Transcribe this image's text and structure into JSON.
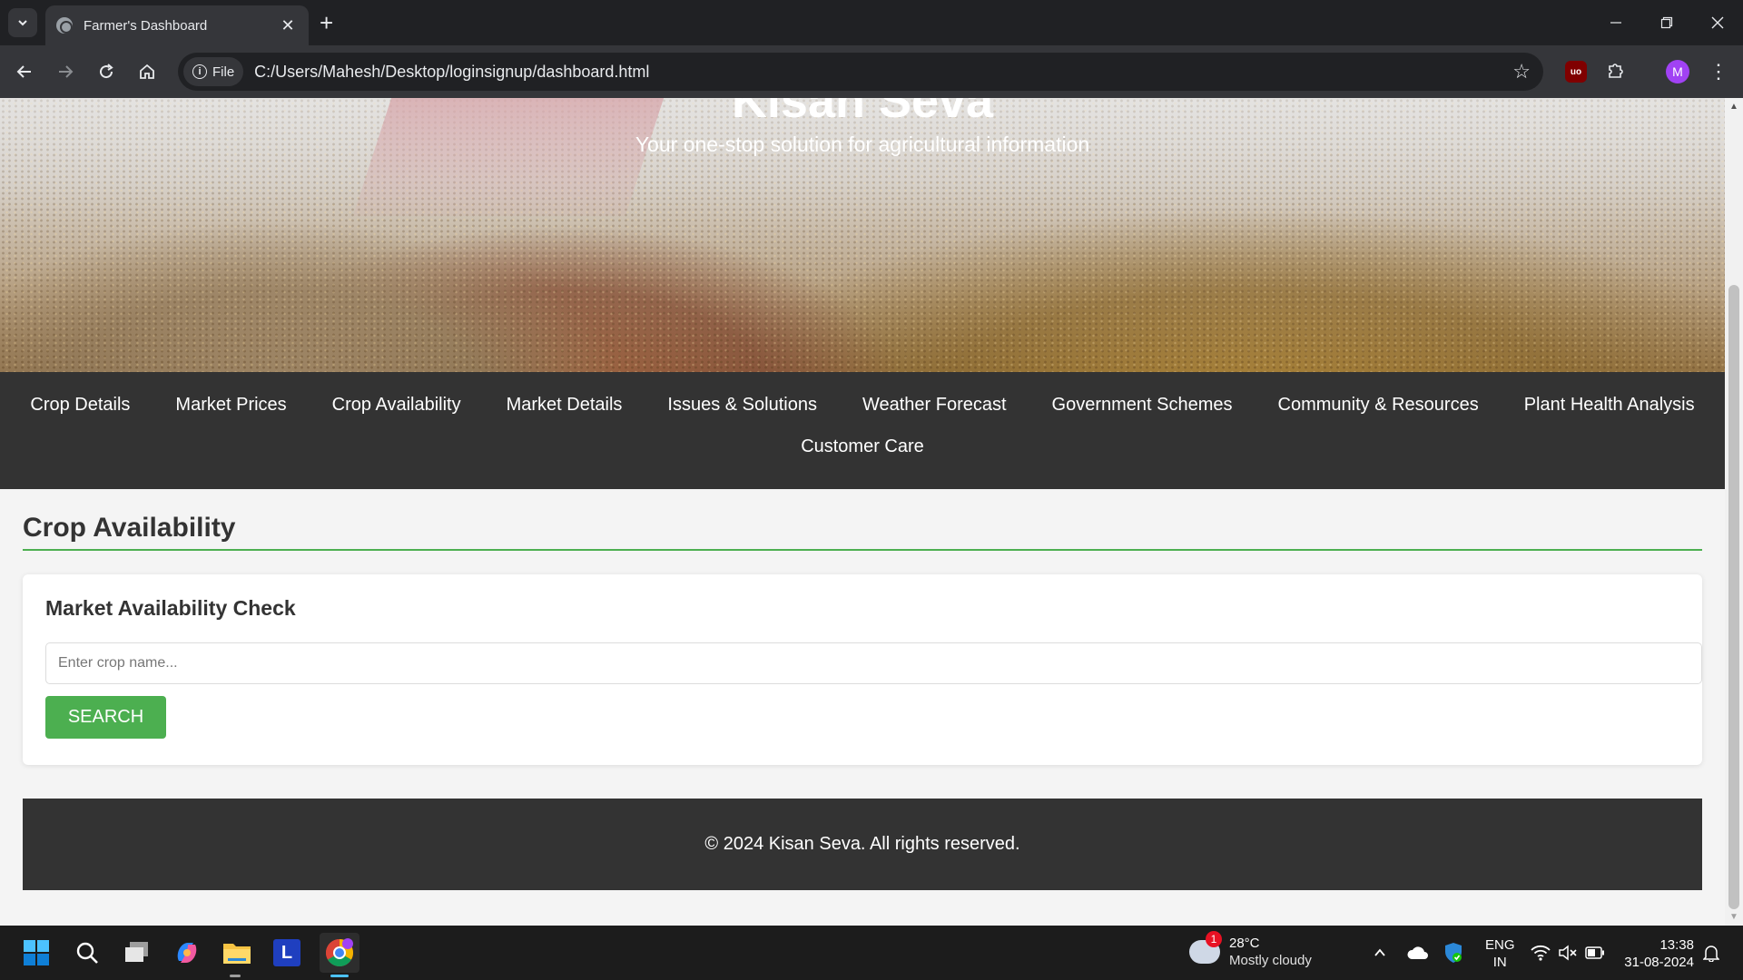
{
  "browser": {
    "tab_title": "Farmer's Dashboard",
    "site_chip": "File",
    "url": "C:/Users/Mahesh/Desktop/loginsignup/dashboard.html",
    "profile_initial": "M",
    "ext_ublock": "uo"
  },
  "hero": {
    "title": "Kisan Seva",
    "subtitle": "Your one-stop solution for agricultural information"
  },
  "nav": {
    "items": [
      "Crop Details",
      "Market Prices",
      "Crop Availability",
      "Market Details",
      "Issues & Solutions",
      "Weather Forecast",
      "Government Schemes",
      "Community & Resources",
      "Plant Health Analysis",
      "Customer Care"
    ]
  },
  "section": {
    "title": "Crop Availability",
    "card_title": "Market Availability Check",
    "input_placeholder": "Enter crop name...",
    "search_label": "SEARCH"
  },
  "footer": {
    "text": "© 2024 Kisan Seva. All rights reserved."
  },
  "taskbar": {
    "weather_badge": "1",
    "weather_temp": "28°C",
    "weather_desc": "Mostly cloudy",
    "lang_line1": "ENG",
    "lang_line2": "IN",
    "time": "13:38",
    "date": "31-08-2024",
    "launcher_l": "L"
  },
  "colors": {
    "accent_green": "#4caf50",
    "nav_bg": "#333333",
    "profile_purple": "#a142f4"
  }
}
